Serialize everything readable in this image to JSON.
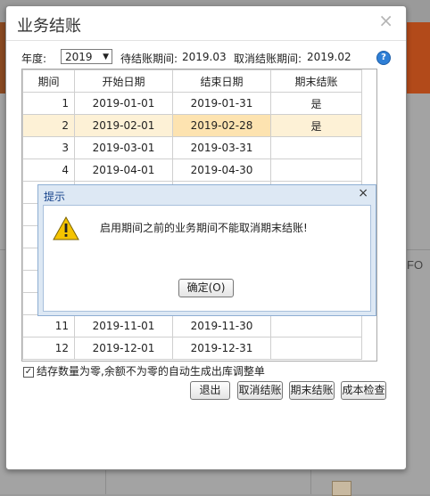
{
  "background": {
    "fo_text": "FO"
  },
  "dialog": {
    "title": "业务结账",
    "close": "×",
    "filters": {
      "year_label": "年度:",
      "year_value": "2019",
      "pending_label": "待结账期间:",
      "pending_value": "2019.03",
      "cancel_label": "取消结账期间:",
      "cancel_value": "2019.02"
    },
    "help_icon": "?",
    "table": {
      "headers": [
        "期间",
        "开始日期",
        "结束日期",
        "期末结账"
      ],
      "rows": [
        {
          "period": "1",
          "start": "2019-01-01",
          "end": "2019-01-31",
          "closed": "是"
        },
        {
          "period": "2",
          "start": "2019-02-01",
          "end": "2019-02-28",
          "closed": "是"
        },
        {
          "period": "3",
          "start": "2019-03-01",
          "end": "2019-03-31",
          "closed": ""
        },
        {
          "period": "4",
          "start": "2019-04-01",
          "end": "2019-04-30",
          "closed": ""
        },
        {
          "period": "",
          "start": "",
          "end": "",
          "closed": ""
        },
        {
          "period": "",
          "start": "",
          "end": "",
          "closed": ""
        },
        {
          "period": "",
          "start": "",
          "end": "",
          "closed": ""
        },
        {
          "period": "",
          "start": "",
          "end": "",
          "closed": ""
        },
        {
          "period": "",
          "start": "",
          "end": "",
          "closed": ""
        },
        {
          "period": "",
          "start": "",
          "end": "",
          "closed": ""
        },
        {
          "period": "11",
          "start": "2019-11-01",
          "end": "2019-11-30",
          "closed": ""
        },
        {
          "period": "12",
          "start": "2019-12-01",
          "end": "2019-12-31",
          "closed": ""
        }
      ]
    },
    "checkbox": {
      "checked": "✓",
      "label": "结存数量为零,余额不为零的自动生成出库调整单"
    },
    "buttons": {
      "exit": "退出",
      "cancel_close": "取消结账",
      "period_close": "期末结账",
      "cost_check": "成本检查"
    }
  },
  "alert": {
    "title": "提示",
    "close": "×",
    "message": "启用期间之前的业务期间不能取消期末结账!",
    "ok": "确定(O)"
  }
}
